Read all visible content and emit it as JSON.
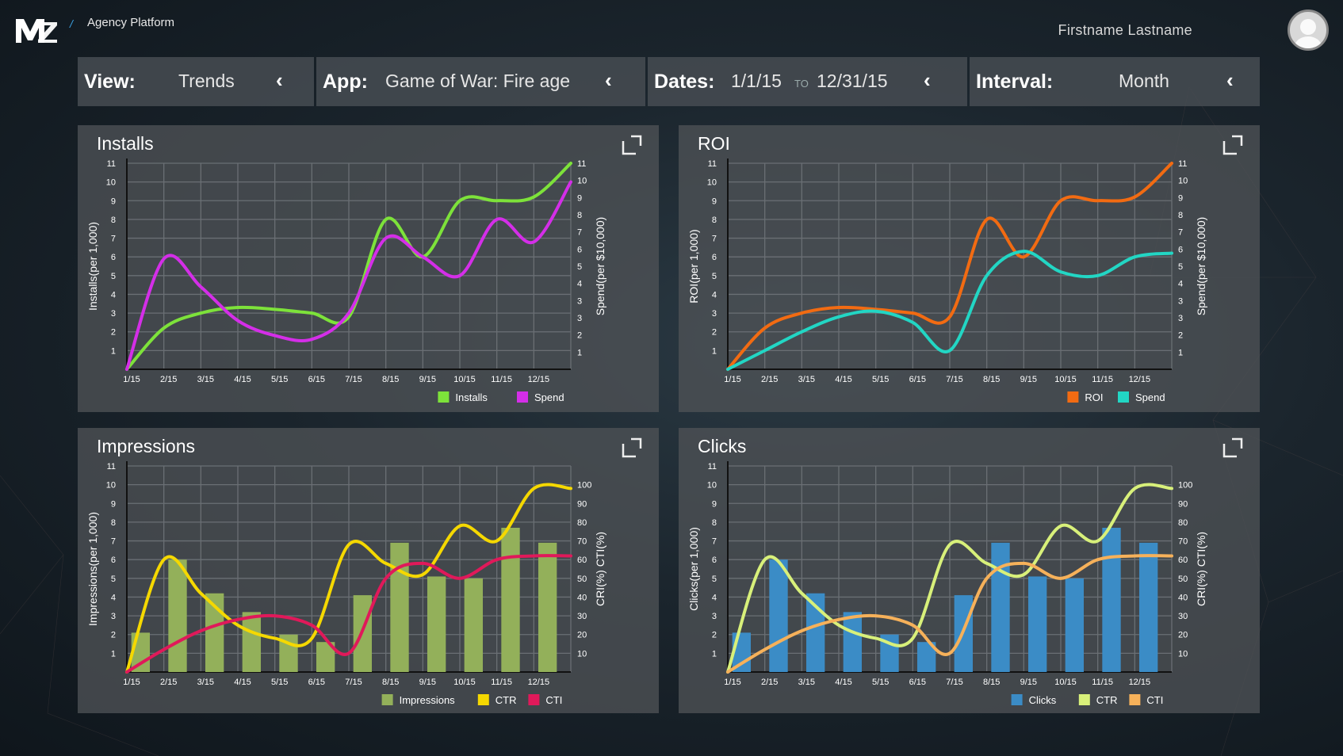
{
  "header": {
    "logo_text": "MZ",
    "separator": "/",
    "app_name": "Agency Platform",
    "user_name": "Firstname Lastname"
  },
  "filters": {
    "view": {
      "label": "View:",
      "value": "Trends"
    },
    "app": {
      "label": "App:",
      "value": "Game of War: Fire age"
    },
    "dates": {
      "label": "Dates:",
      "from": "1/1/15",
      "to_word": "TO",
      "to": "12/31/15"
    },
    "interval": {
      "label": "Interval:",
      "value": "Month"
    }
  },
  "icons": {
    "back": "chevron-left-icon",
    "expand": "expand-icon",
    "user": "user-avatar-icon"
  },
  "colors": {
    "installs": "#7de23a",
    "spend_purple": "#d42ee8",
    "roi": "#f26b12",
    "spend_cyan": "#22d6c4",
    "impressions_bar": "#93b05a",
    "ctr_yellow": "#f5d800",
    "cti_pink": "#e0195a",
    "clicks_bar": "#3b8cc6",
    "ctr_lime": "#d8f07a",
    "cti_orange": "#f6b15a"
  },
  "panels": {
    "installs": {
      "title": "Installs"
    },
    "roi": {
      "title": "ROI"
    },
    "impressions": {
      "title": "Impressions"
    },
    "clicks": {
      "title": "Clicks"
    }
  },
  "chart_data": [
    {
      "type": "line",
      "title": "Installs",
      "categories": [
        "1/15",
        "2/15",
        "3/15",
        "4/15",
        "5/15",
        "6/15",
        "7/15",
        "8/15",
        "9/15",
        "10/15",
        "11/15",
        "12/15"
      ],
      "ylabel": "Installs(per 1,000)",
      "ylabel_right": "Spend(per $10,000)",
      "y_ticks": [
        1,
        2,
        3,
        4,
        5,
        6,
        7,
        8,
        9,
        10,
        11
      ],
      "y2_ticks": [
        1,
        2,
        3,
        3,
        4,
        5,
        6,
        7,
        8,
        9,
        10,
        11
      ],
      "ylim": [
        0,
        11
      ],
      "series": [
        {
          "name": "Installs",
          "axis": "left",
          "color": "#7de23a",
          "x": [
            0,
            1,
            2,
            3,
            4,
            5,
            6,
            7,
            8,
            9,
            10,
            11,
            12
          ],
          "values": [
            0,
            2.2,
            3.0,
            3.3,
            3.2,
            3.0,
            2.8,
            8.0,
            6.0,
            9.0,
            9.0,
            9.2,
            11.0
          ]
        },
        {
          "name": "Spend",
          "axis": "left",
          "color": "#d42ee8",
          "x": [
            0,
            1,
            2,
            3,
            4,
            5,
            6,
            7,
            8,
            9,
            10,
            11,
            12
          ],
          "values": [
            0,
            5.9,
            4.4,
            2.6,
            1.8,
            1.6,
            3.0,
            7.0,
            6.0,
            5.0,
            8.0,
            6.8,
            10.0
          ]
        }
      ],
      "legend": "bottom-right"
    },
    {
      "type": "line",
      "title": "ROI",
      "categories": [
        "1/15",
        "2/15",
        "3/15",
        "4/15",
        "5/15",
        "6/15",
        "7/15",
        "8/15",
        "9/15",
        "10/15",
        "11/15",
        "12/15"
      ],
      "ylabel": "ROI(per 1,000)",
      "ylabel_right": "Spend(per $10,000)",
      "y_ticks": [
        1,
        2,
        3,
        4,
        5,
        6,
        7,
        8,
        9,
        10,
        11
      ],
      "y2_ticks": [
        1,
        2,
        3,
        3,
        4,
        5,
        6,
        7,
        8,
        9,
        10,
        11
      ],
      "ylim": [
        0,
        11
      ],
      "series": [
        {
          "name": "ROI",
          "axis": "left",
          "color": "#f26b12",
          "x": [
            0,
            1,
            2,
            3,
            4,
            5,
            6,
            7,
            8,
            9,
            10,
            11,
            12
          ],
          "values": [
            0,
            2.2,
            3.0,
            3.3,
            3.2,
            3.0,
            2.8,
            8.0,
            6.0,
            9.0,
            9.0,
            9.2,
            11.0
          ]
        },
        {
          "name": "Spend",
          "axis": "left",
          "color": "#22d6c4",
          "x": [
            0,
            1,
            2,
            3,
            4,
            5,
            6,
            7,
            8,
            9,
            10,
            11,
            12
          ],
          "values": [
            0,
            1.0,
            2.0,
            2.8,
            3.1,
            2.5,
            1.0,
            5.0,
            6.3,
            5.2,
            5.0,
            6.0,
            6.2
          ]
        }
      ],
      "legend": "bottom-right"
    },
    {
      "type": "bar",
      "title": "Impressions",
      "categories": [
        "1/15",
        "2/15",
        "3/15",
        "4/15",
        "5/15",
        "6/15",
        "7/15",
        "8/15",
        "9/15",
        "10/15",
        "11/15",
        "12/15"
      ],
      "ylabel": "Impressions(per 1,000)",
      "ylabel_right": "CRI(%) CTI(%)",
      "y_ticks": [
        1,
        2,
        3,
        4,
        5,
        6,
        7,
        8,
        9,
        10,
        11
      ],
      "y2_ticks": [
        10,
        20,
        30,
        40,
        50,
        60,
        70,
        80,
        90,
        100
      ],
      "ylim": [
        0,
        11
      ],
      "y2lim": [
        0,
        110
      ],
      "bars": {
        "name": "Impressions",
        "color": "#93b05a",
        "values": [
          2.1,
          6.0,
          4.2,
          3.2,
          2.0,
          1.6,
          4.1,
          6.9,
          5.1,
          5.0,
          7.7,
          6.9
        ]
      },
      "series": [
        {
          "name": "CTR",
          "axis": "right",
          "color": "#f5d800",
          "x": [
            0,
            1,
            2,
            3,
            4,
            5,
            6,
            7,
            8,
            9,
            10,
            11,
            12
          ],
          "values": [
            0,
            60,
            42,
            25,
            18,
            18,
            68,
            58,
            52,
            78,
            70,
            98,
            98
          ]
        },
        {
          "name": "CTI",
          "axis": "right",
          "color": "#e0195a",
          "x": [
            0,
            1,
            2,
            3,
            4,
            5,
            6,
            7,
            8,
            9,
            10,
            11,
            12
          ],
          "values": [
            0,
            12,
            22,
            28,
            30,
            25,
            10,
            50,
            58,
            50,
            60,
            62,
            62
          ]
        }
      ],
      "legend": "bottom-right"
    },
    {
      "type": "bar",
      "title": "Clicks",
      "categories": [
        "1/15",
        "2/15",
        "3/15",
        "4/15",
        "5/15",
        "6/15",
        "7/15",
        "8/15",
        "9/15",
        "10/15",
        "11/15",
        "12/15"
      ],
      "ylabel": "Clicks(per 1,000)",
      "ylabel_right": "CRI(%) CTI(%)",
      "y_ticks": [
        1,
        2,
        3,
        4,
        5,
        6,
        7,
        8,
        9,
        10,
        11
      ],
      "y2_ticks": [
        10,
        20,
        30,
        40,
        50,
        60,
        70,
        80,
        90,
        100
      ],
      "ylim": [
        0,
        11
      ],
      "y2lim": [
        0,
        110
      ],
      "bars": {
        "name": "Clicks",
        "color": "#3b8cc6",
        "values": [
          2.1,
          6.0,
          4.2,
          3.2,
          2.0,
          1.6,
          4.1,
          6.9,
          5.1,
          5.0,
          7.7,
          6.9
        ]
      },
      "series": [
        {
          "name": "CTR",
          "axis": "right",
          "color": "#d8f07a",
          "x": [
            0,
            1,
            2,
            3,
            4,
            5,
            6,
            7,
            8,
            9,
            10,
            11,
            12
          ],
          "values": [
            0,
            60,
            42,
            25,
            18,
            18,
            68,
            58,
            52,
            78,
            70,
            98,
            98
          ]
        },
        {
          "name": "CTI",
          "axis": "right",
          "color": "#f6b15a",
          "x": [
            0,
            1,
            2,
            3,
            4,
            5,
            6,
            7,
            8,
            9,
            10,
            11,
            12
          ],
          "values": [
            0,
            12,
            22,
            28,
            30,
            25,
            10,
            50,
            58,
            50,
            60,
            62,
            62
          ]
        }
      ],
      "legend": "bottom-right"
    }
  ]
}
